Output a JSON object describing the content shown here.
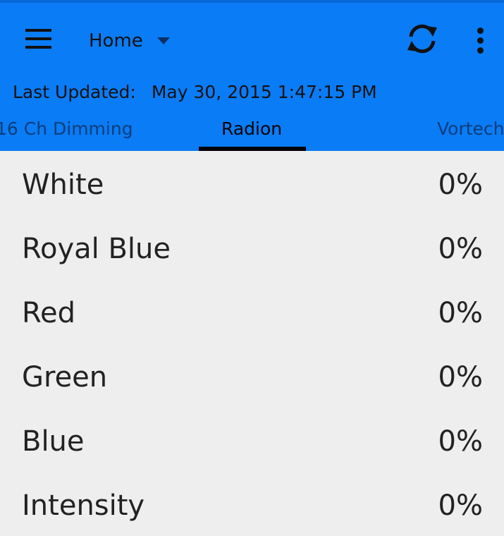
{
  "header": {
    "nav_title": "Home",
    "last_updated_label": "Last Updated:",
    "last_updated_value": "May 30, 2015 1:47:15 PM",
    "icons": [
      "menu-icon",
      "dropdown-caret-icon",
      "refresh-icon",
      "overflow-menu-icon"
    ]
  },
  "tabs": [
    {
      "label": "16 Ch Dimming"
    },
    {
      "label": "Radion"
    },
    {
      "label": "Vortech"
    }
  ],
  "active_tab": "Radion",
  "channels": [
    {
      "name": "White",
      "value": "0%"
    },
    {
      "name": "Royal Blue",
      "value": "0%"
    },
    {
      "name": "Red",
      "value": "0%"
    },
    {
      "name": "Green",
      "value": "0%"
    },
    {
      "name": "Blue",
      "value": "0%"
    },
    {
      "name": "Intensity",
      "value": "0%"
    }
  ],
  "colors": {
    "appbar": "#0a7cf5",
    "background": "#eeeeee",
    "text": "#222222"
  }
}
